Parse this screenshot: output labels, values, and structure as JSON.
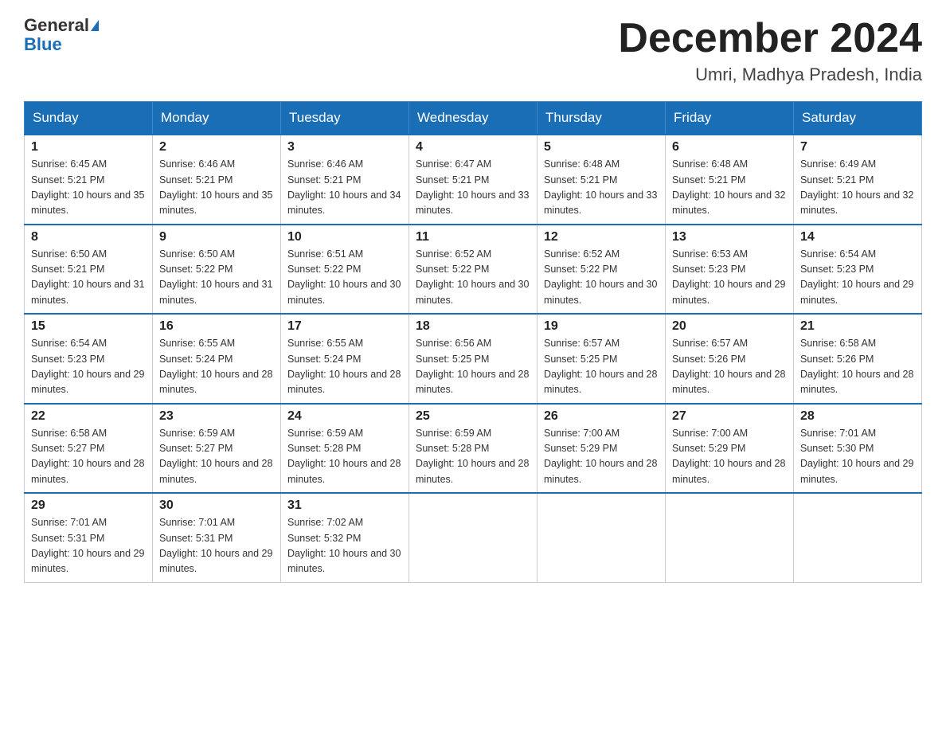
{
  "logo": {
    "general": "General",
    "blue": "Blue"
  },
  "title": "December 2024",
  "subtitle": "Umri, Madhya Pradesh, India",
  "days_of_week": [
    "Sunday",
    "Monday",
    "Tuesday",
    "Wednesday",
    "Thursday",
    "Friday",
    "Saturday"
  ],
  "weeks": [
    [
      {
        "day": "1",
        "sunrise": "6:45 AM",
        "sunset": "5:21 PM",
        "daylight": "10 hours and 35 minutes."
      },
      {
        "day": "2",
        "sunrise": "6:46 AM",
        "sunset": "5:21 PM",
        "daylight": "10 hours and 35 minutes."
      },
      {
        "day": "3",
        "sunrise": "6:46 AM",
        "sunset": "5:21 PM",
        "daylight": "10 hours and 34 minutes."
      },
      {
        "day": "4",
        "sunrise": "6:47 AM",
        "sunset": "5:21 PM",
        "daylight": "10 hours and 33 minutes."
      },
      {
        "day": "5",
        "sunrise": "6:48 AM",
        "sunset": "5:21 PM",
        "daylight": "10 hours and 33 minutes."
      },
      {
        "day": "6",
        "sunrise": "6:48 AM",
        "sunset": "5:21 PM",
        "daylight": "10 hours and 32 minutes."
      },
      {
        "day": "7",
        "sunrise": "6:49 AM",
        "sunset": "5:21 PM",
        "daylight": "10 hours and 32 minutes."
      }
    ],
    [
      {
        "day": "8",
        "sunrise": "6:50 AM",
        "sunset": "5:21 PM",
        "daylight": "10 hours and 31 minutes."
      },
      {
        "day": "9",
        "sunrise": "6:50 AM",
        "sunset": "5:22 PM",
        "daylight": "10 hours and 31 minutes."
      },
      {
        "day": "10",
        "sunrise": "6:51 AM",
        "sunset": "5:22 PM",
        "daylight": "10 hours and 30 minutes."
      },
      {
        "day": "11",
        "sunrise": "6:52 AM",
        "sunset": "5:22 PM",
        "daylight": "10 hours and 30 minutes."
      },
      {
        "day": "12",
        "sunrise": "6:52 AM",
        "sunset": "5:22 PM",
        "daylight": "10 hours and 30 minutes."
      },
      {
        "day": "13",
        "sunrise": "6:53 AM",
        "sunset": "5:23 PM",
        "daylight": "10 hours and 29 minutes."
      },
      {
        "day": "14",
        "sunrise": "6:54 AM",
        "sunset": "5:23 PM",
        "daylight": "10 hours and 29 minutes."
      }
    ],
    [
      {
        "day": "15",
        "sunrise": "6:54 AM",
        "sunset": "5:23 PM",
        "daylight": "10 hours and 29 minutes."
      },
      {
        "day": "16",
        "sunrise": "6:55 AM",
        "sunset": "5:24 PM",
        "daylight": "10 hours and 28 minutes."
      },
      {
        "day": "17",
        "sunrise": "6:55 AM",
        "sunset": "5:24 PM",
        "daylight": "10 hours and 28 minutes."
      },
      {
        "day": "18",
        "sunrise": "6:56 AM",
        "sunset": "5:25 PM",
        "daylight": "10 hours and 28 minutes."
      },
      {
        "day": "19",
        "sunrise": "6:57 AM",
        "sunset": "5:25 PM",
        "daylight": "10 hours and 28 minutes."
      },
      {
        "day": "20",
        "sunrise": "6:57 AM",
        "sunset": "5:26 PM",
        "daylight": "10 hours and 28 minutes."
      },
      {
        "day": "21",
        "sunrise": "6:58 AM",
        "sunset": "5:26 PM",
        "daylight": "10 hours and 28 minutes."
      }
    ],
    [
      {
        "day": "22",
        "sunrise": "6:58 AM",
        "sunset": "5:27 PM",
        "daylight": "10 hours and 28 minutes."
      },
      {
        "day": "23",
        "sunrise": "6:59 AM",
        "sunset": "5:27 PM",
        "daylight": "10 hours and 28 minutes."
      },
      {
        "day": "24",
        "sunrise": "6:59 AM",
        "sunset": "5:28 PM",
        "daylight": "10 hours and 28 minutes."
      },
      {
        "day": "25",
        "sunrise": "6:59 AM",
        "sunset": "5:28 PM",
        "daylight": "10 hours and 28 minutes."
      },
      {
        "day": "26",
        "sunrise": "7:00 AM",
        "sunset": "5:29 PM",
        "daylight": "10 hours and 28 minutes."
      },
      {
        "day": "27",
        "sunrise": "7:00 AM",
        "sunset": "5:29 PM",
        "daylight": "10 hours and 28 minutes."
      },
      {
        "day": "28",
        "sunrise": "7:01 AM",
        "sunset": "5:30 PM",
        "daylight": "10 hours and 29 minutes."
      }
    ],
    [
      {
        "day": "29",
        "sunrise": "7:01 AM",
        "sunset": "5:31 PM",
        "daylight": "10 hours and 29 minutes."
      },
      {
        "day": "30",
        "sunrise": "7:01 AM",
        "sunset": "5:31 PM",
        "daylight": "10 hours and 29 minutes."
      },
      {
        "day": "31",
        "sunrise": "7:02 AM",
        "sunset": "5:32 PM",
        "daylight": "10 hours and 30 minutes."
      },
      null,
      null,
      null,
      null
    ]
  ]
}
